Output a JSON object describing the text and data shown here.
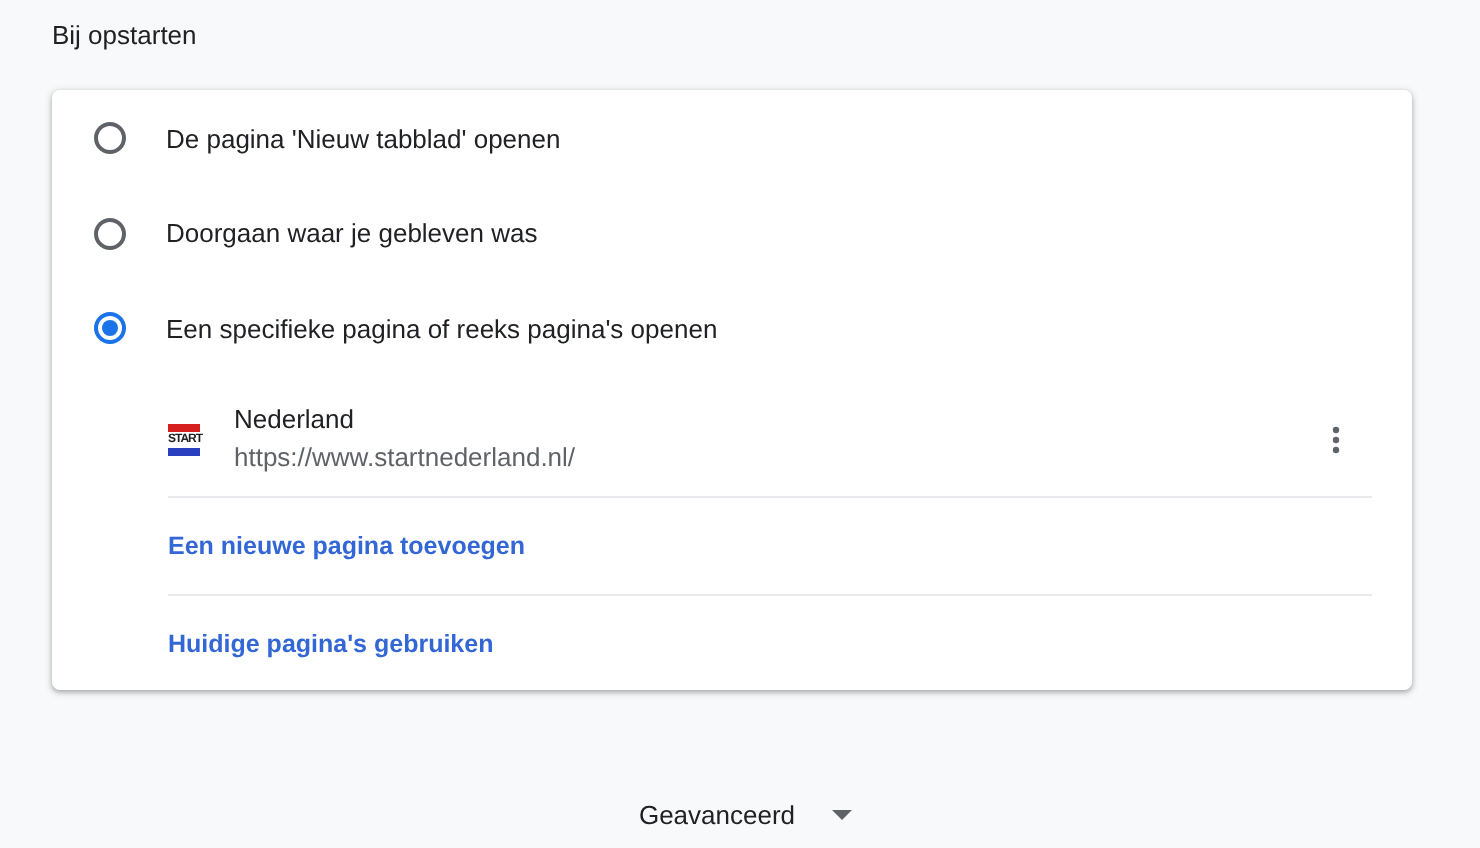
{
  "section_title": "Bij opstarten",
  "options": [
    {
      "label": "De pagina 'Nieuw tabblad' openen",
      "selected": false
    },
    {
      "label": "Doorgaan waar je gebleven was",
      "selected": false
    },
    {
      "label": "Een specifieke pagina of reeks pagina's openen",
      "selected": true
    }
  ],
  "pages": [
    {
      "favicon_text": "START",
      "title": "Nederland",
      "url": "https://www.startnederland.nl/"
    }
  ],
  "links": [
    "Een nieuwe pagina toevoegen",
    "Huidige pagina's gebruiken"
  ],
  "advanced": {
    "label": "Geavanceerd",
    "expanded": false
  }
}
